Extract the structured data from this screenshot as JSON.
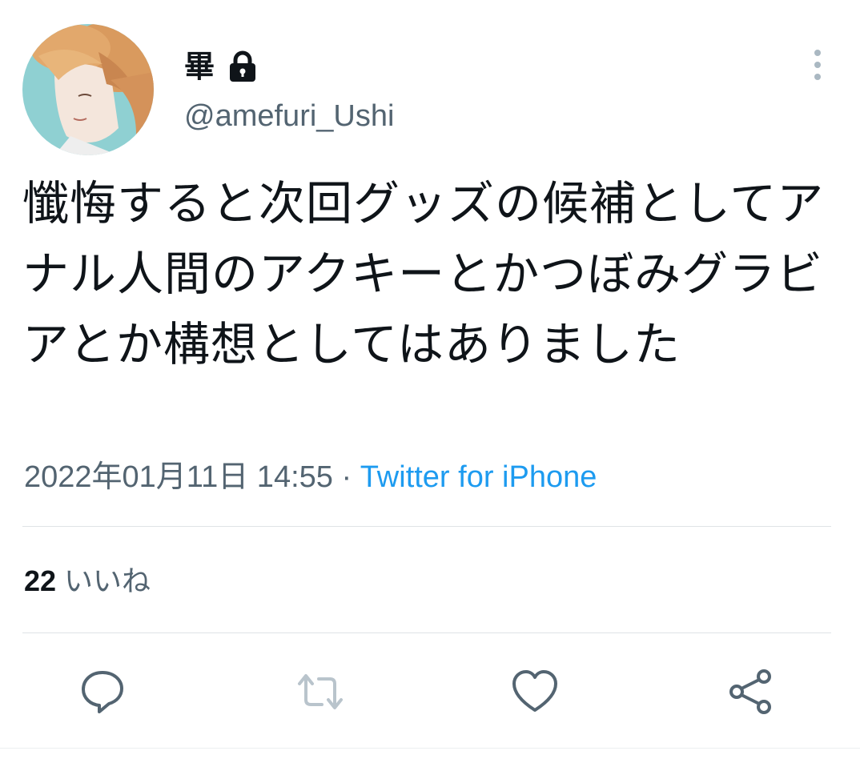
{
  "author": {
    "display_name": "畢",
    "handle": "@amefuri_Ushi",
    "protected_icon": "lock-icon",
    "avatar_icon": "avatar-illustration"
  },
  "tweet": {
    "text": "懺悔すると次回グッズの候補としてアナル人間のアクキーとかつぼみグラビアとか構想としてはありました",
    "timestamp": "2022年01月11日 14:55",
    "separator": " · ",
    "source": "Twitter for iPhone"
  },
  "stats": {
    "likes_count": "22",
    "likes_label": "いいね"
  },
  "actions": {
    "reply_icon": "reply-icon",
    "retweet_icon": "retweet-icon",
    "like_icon": "heart-icon",
    "share_icon": "share-icon"
  },
  "colors": {
    "text_primary": "#0f1419",
    "text_secondary": "#536471",
    "link": "#1d9bf0",
    "icon": "#536471",
    "divider": "#dfe3e6"
  }
}
